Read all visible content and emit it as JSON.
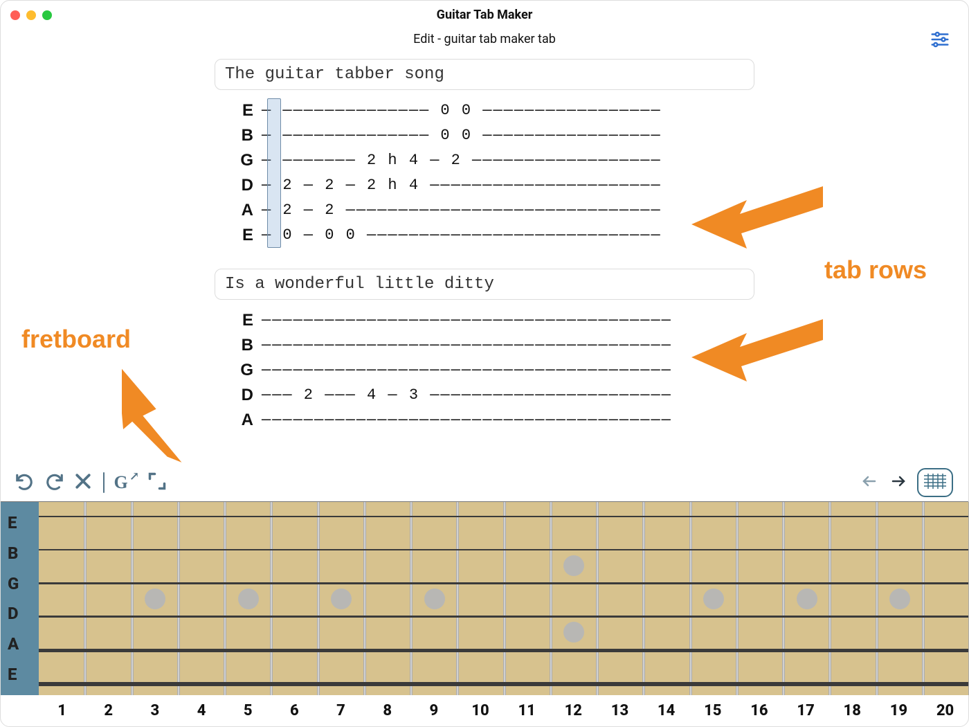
{
  "window": {
    "title": "Guitar Tab Maker"
  },
  "header": {
    "subtitle": "Edit - guitar tab maker tab"
  },
  "settings_icon": "settings",
  "colors": {
    "accent": "#f08a24",
    "tool": "#537387",
    "brand": "#3b6e85",
    "fretboard_wood": "#d7c28e",
    "nut": "#5d8aa1"
  },
  "sections": [
    {
      "lyric": "The guitar tabber song",
      "has_cursor": true,
      "rows": [
        {
          "label": "E",
          "content": "— —————————————— 0 0 —————————————————"
        },
        {
          "label": "B",
          "content": "— —————————————— 0 0 —————————————————"
        },
        {
          "label": "G",
          "content": "— ——————— 2 h 4 — 2 ——————————————————"
        },
        {
          "label": "D",
          "content": "— 2 — 2 — 2 h 4 ——————————————————————"
        },
        {
          "label": "A",
          "content": "— 2 — 2 ——————————————————————————————"
        },
        {
          "label": "E",
          "content": "— 0 — 0 0 ————————————————————————————"
        }
      ]
    },
    {
      "lyric": "Is a wonderful little ditty",
      "has_cursor": false,
      "rows": [
        {
          "label": "E",
          "content": "———————————————————————————————————————"
        },
        {
          "label": "B",
          "content": "———————————————————————————————————————"
        },
        {
          "label": "G",
          "content": "———————————————————————————————————————"
        },
        {
          "label": "D",
          "content": "——— 2 ——— 4 — 3 ———————————————————————"
        },
        {
          "label": "A",
          "content": "———————————————————————————————————————"
        }
      ]
    }
  ],
  "tools": {
    "undo": "undo",
    "redo": "redo",
    "delete": "delete",
    "chord": "G↗",
    "fullscreen": "fullscreen",
    "prev": "←",
    "next": "→",
    "panel": "panel"
  },
  "annotations": {
    "fretboard": "fretboard",
    "tab_rows": "tab rows"
  },
  "fretboard": {
    "strings": [
      "E",
      "B",
      "G",
      "D",
      "A",
      "E"
    ],
    "string_weights": [
      2,
      2,
      3,
      3,
      5,
      6
    ],
    "fret_count": 20,
    "markers_single": [
      3,
      5,
      7,
      9,
      15,
      17,
      19
    ],
    "markers_double": [
      12
    ],
    "numbers": [
      "1",
      "2",
      "3",
      "4",
      "5",
      "6",
      "7",
      "8",
      "9",
      "10",
      "11",
      "12",
      "13",
      "14",
      "15",
      "16",
      "17",
      "18",
      "19",
      "20"
    ]
  }
}
